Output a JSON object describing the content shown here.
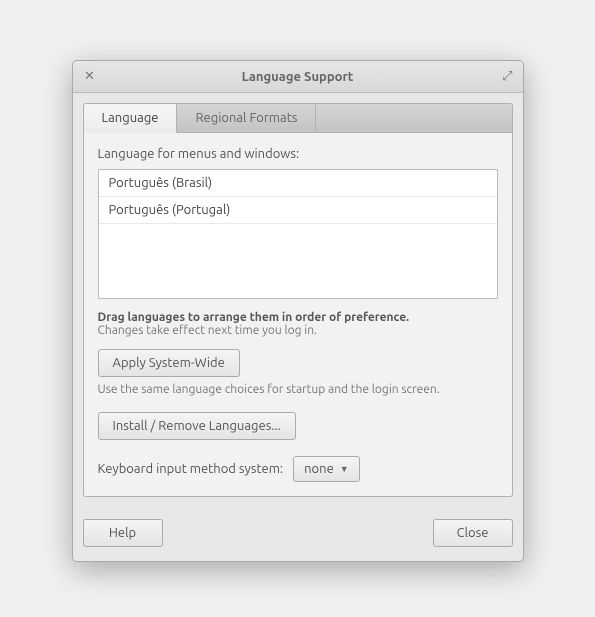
{
  "window": {
    "title": "Language Support"
  },
  "tabs": [
    {
      "label": "Language",
      "active": true
    },
    {
      "label": "Regional Formats",
      "active": false
    }
  ],
  "main": {
    "list_label": "Language for menus and windows:",
    "languages": [
      "Português (Brasil)",
      "Português (Portugal)"
    ],
    "drag_hint_bold": "Drag languages to arrange them in order of preference.",
    "drag_hint_sub": "Changes take effect next time you log in.",
    "apply_button": "Apply System-Wide",
    "apply_hint": "Use the same language choices for startup and the login screen.",
    "install_button": "Install / Remove Languages...",
    "input_method_label": "Keyboard input method system:",
    "input_method_value": "none"
  },
  "footer": {
    "help": "Help",
    "close": "Close"
  }
}
